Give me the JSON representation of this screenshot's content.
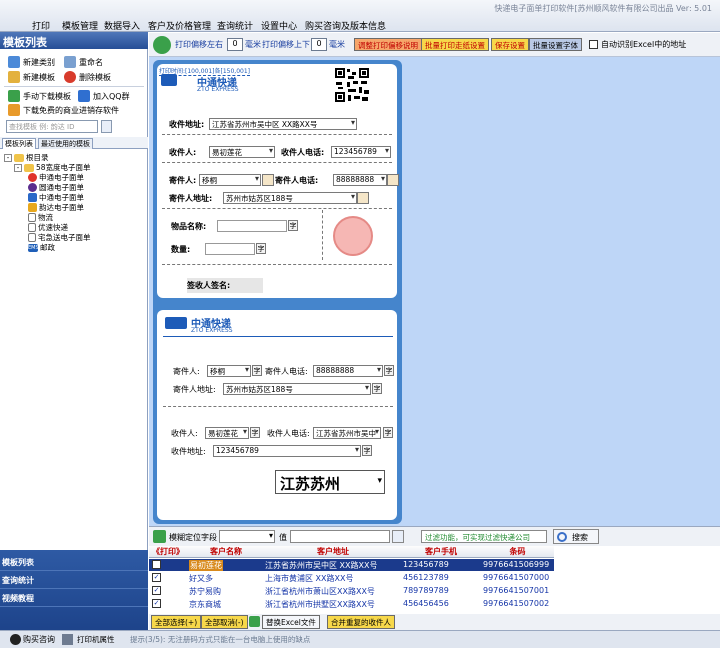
{
  "app": {
    "title": "快递电子面单打印软件[苏州顺风软件有限公司出品   Ver: 5.01"
  },
  "menu": [
    "打印",
    "模板管理",
    "数据导入",
    "客户及价格管理",
    "查询统计",
    "设置中心",
    "购买咨询及版本信息"
  ],
  "left": {
    "header": "模板列表",
    "actions": {
      "new_category": "新建类别",
      "rename": "重命名",
      "new_template": "新建模板",
      "delete_template": "删除模板",
      "manual_download": "手动下载模板",
      "join_qq": "加入QQ群",
      "download_free": "下载免费的商业进销存软件"
    },
    "search_placeholder": "查找模板 例: 韵达 ID",
    "tabs": [
      "模板列表",
      "最近使用的模板"
    ],
    "tree": {
      "root": "根目录",
      "group": "58宽度电子面单",
      "children": [
        "申通电子面单",
        "圆通电子面单",
        "中通电子面单",
        "韵达电子面单",
        "物流",
        "优速快递",
        "宅急送电子面单",
        "邮政"
      ]
    },
    "bottom_nav": [
      "模板列表",
      "查询统计",
      "视频教程"
    ]
  },
  "toolbar": {
    "offset_lr_label": "打印偏移左右",
    "offset_lr_value": "0",
    "unit1": "毫米",
    "offset_ud_label": "打印偏移上下",
    "offset_ud_value": "0",
    "unit2": "毫米",
    "btn_adjust": "调整打印偏移说明",
    "btn_batch_paper": "批量打印走纸设置",
    "btn_save": "保存设置",
    "btn_font": "批量设置字体",
    "auto_detect": "自动识别Excel中的地址"
  },
  "form": {
    "top_code": "打印时间:[100,001]各[150,001]",
    "brand_name": "中通快递",
    "brand_sub": "ZTO EXPRESS",
    "recv_addr_label": "收件地址:",
    "recv_addr_value": "江苏省苏州市吴中区 XX路XX号",
    "recv_name_label": "收件人:",
    "recv_name_value": "易初莲花",
    "recv_phone_label": "收件人电话:",
    "recv_phone_value": "123456789",
    "send_name_label": "寄件人:",
    "send_name_value": "移桐",
    "send_phone_label": "寄件人电话:",
    "send_phone_value": "88888888",
    "send_addr_label": "寄件人地址:",
    "send_addr_value": "苏州市姑苏区188号",
    "item_label": "物品名称:",
    "qty_label": "数量:",
    "zi": "字",
    "sign_label": "签收人签名:",
    "lower_send_name": "移桐",
    "lower_recv_name": "易初莲花",
    "lower_recv_addr_inline": "江苏省苏州市吴中",
    "lower_recv_addr_value": "123456789",
    "big_text": "江苏苏州",
    "lower_recv_addr_label": "收件地址:"
  },
  "filter": {
    "field_label": "模糊定位字段",
    "value_label": "值",
    "filter_text": "过滤功能，可实现过滤快递公司",
    "search_btn": "搜索"
  },
  "grid": {
    "columns": [
      "《打印》",
      "客户名称",
      "客户地址",
      "客户手机",
      "条码"
    ],
    "rows": [
      {
        "name": "易初莲花",
        "address": "江苏省苏州市吴中区 XX路XX号",
        "phone": "123456789",
        "barcode": "9976641506999"
      },
      {
        "name": "好又多",
        "address": "上海市黄浦区 XX路XX号",
        "phone": "456123789",
        "barcode": "9976641507000"
      },
      {
        "name": "苏宁易购",
        "address": "浙江省杭州市萧山区XX路XX号",
        "phone": "789789789",
        "barcode": "9976641507001"
      },
      {
        "name": "京东商城",
        "address": "浙江省杭州市拱墅区XX路XX号",
        "phone": "456456456",
        "barcode": "9976641507002"
      }
    ]
  },
  "bottom_buttons": {
    "select_all": "全部选择(+)",
    "deselect_all": "全部取消(-)",
    "replace_excel": "替换Excel文件",
    "merge": "合并重复的收件人"
  },
  "status": {
    "buy": "购买咨询",
    "printer": "打印机属性",
    "tip": "提示(3/5): 无注册码方式只能在一台电脑上使用的缺点"
  },
  "colors": {
    "brand_blue": "#1d5bb8",
    "card_blue": "#4585cc",
    "header_blue": "#2e5aa4",
    "design_bg": "#bed6f7",
    "selected_row": "#1b3a8c"
  }
}
